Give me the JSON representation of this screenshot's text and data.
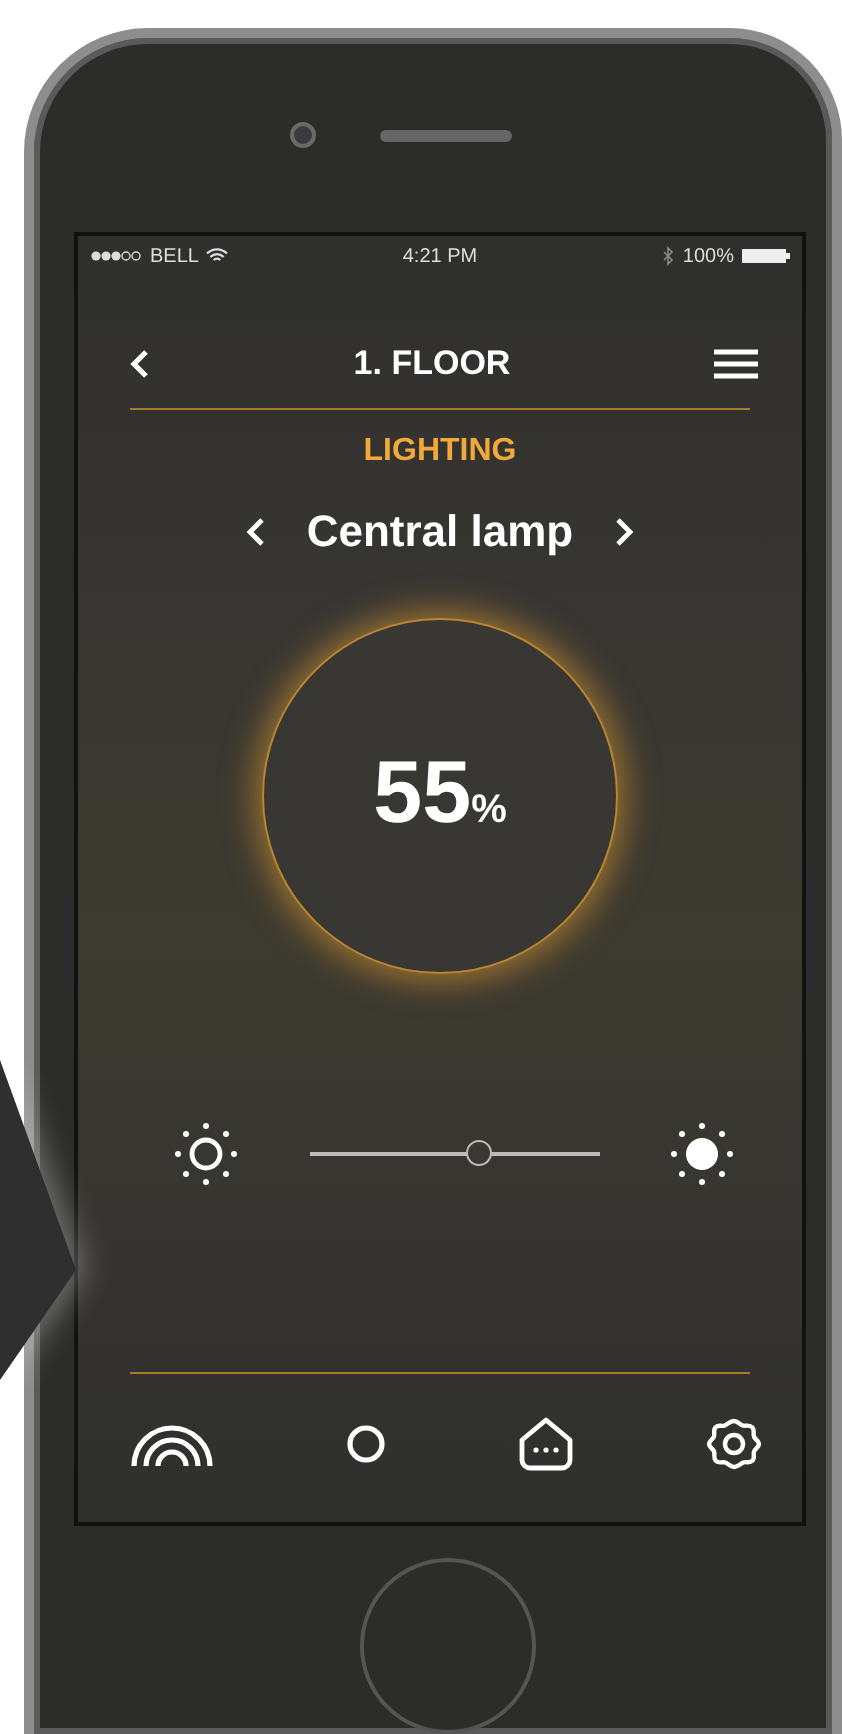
{
  "status_bar": {
    "carrier": "BELL",
    "time": "4:21 PM",
    "battery": "100%"
  },
  "header": {
    "title": "1. FLOOR"
  },
  "section": {
    "title": "LIGHTING"
  },
  "device": {
    "name": "Central lamp"
  },
  "dial": {
    "value": "55",
    "unit": "%"
  },
  "brightness": {
    "level": 0.59
  },
  "nav": [
    {
      "kind": "rainbow"
    },
    {
      "kind": "circle"
    },
    {
      "kind": "home"
    },
    {
      "kind": "gear"
    }
  ]
}
